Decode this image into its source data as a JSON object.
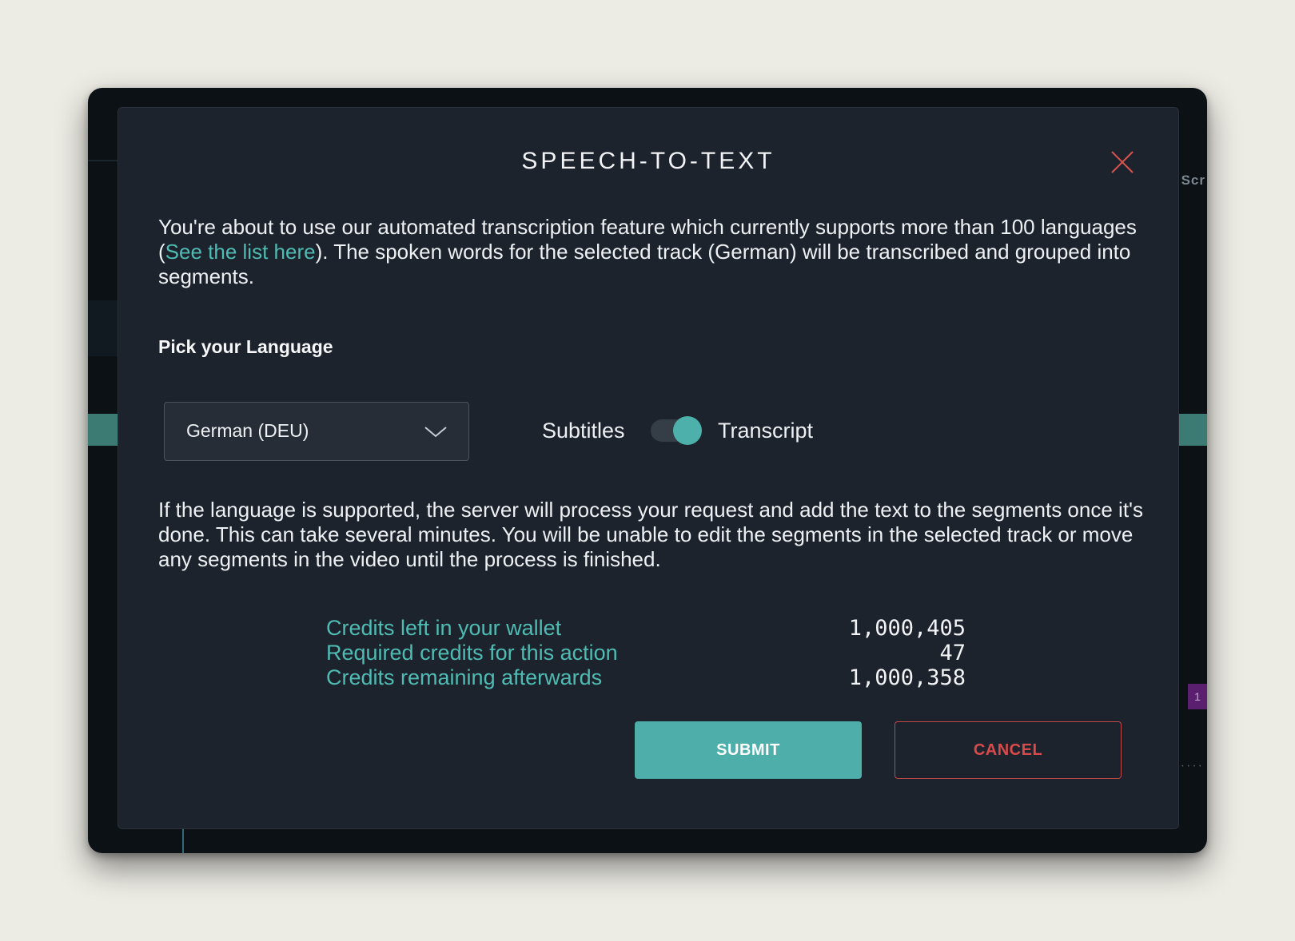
{
  "dialog": {
    "title": "SPEECH-TO-TEXT",
    "close_icon": "close-icon",
    "intro_before_link": "You're about to use our automated transcription feature which currently supports more than 100 languages (",
    "intro_link": "See the list here",
    "intro_after_link": "). The spoken words for the selected track (German) will be transcribed and grouped into segments.",
    "pick_language_label": "Pick your Language",
    "language_select": {
      "value": "German (DEU)",
      "icon": "chevron-down-icon"
    },
    "mode_toggle": {
      "left_label": "Subtitles",
      "right_label": "Transcript",
      "selected": "Transcript"
    },
    "info_text": "If the language is supported, the server will process your request and add the text to the segments once it's done. This can take several minutes. You will be unable to edit the segments in the selected track or move any segments in the video until the process is finished.",
    "credits": [
      {
        "label": "Credits left in your wallet",
        "value": "1,000,405"
      },
      {
        "label": "Required credits for this action",
        "value": "47"
      },
      {
        "label": "Credits remaining afterwards",
        "value": "1,000,358"
      }
    ],
    "submit_label": "SUBMIT",
    "cancel_label": "CANCEL"
  },
  "background": {
    "partial_header": "Scr",
    "partial_badge": "1"
  },
  "colors": {
    "accent": "#4eaea9",
    "link": "#4fbcb4",
    "danger": "#d94a4a",
    "dialog_bg": "#1d232c"
  }
}
